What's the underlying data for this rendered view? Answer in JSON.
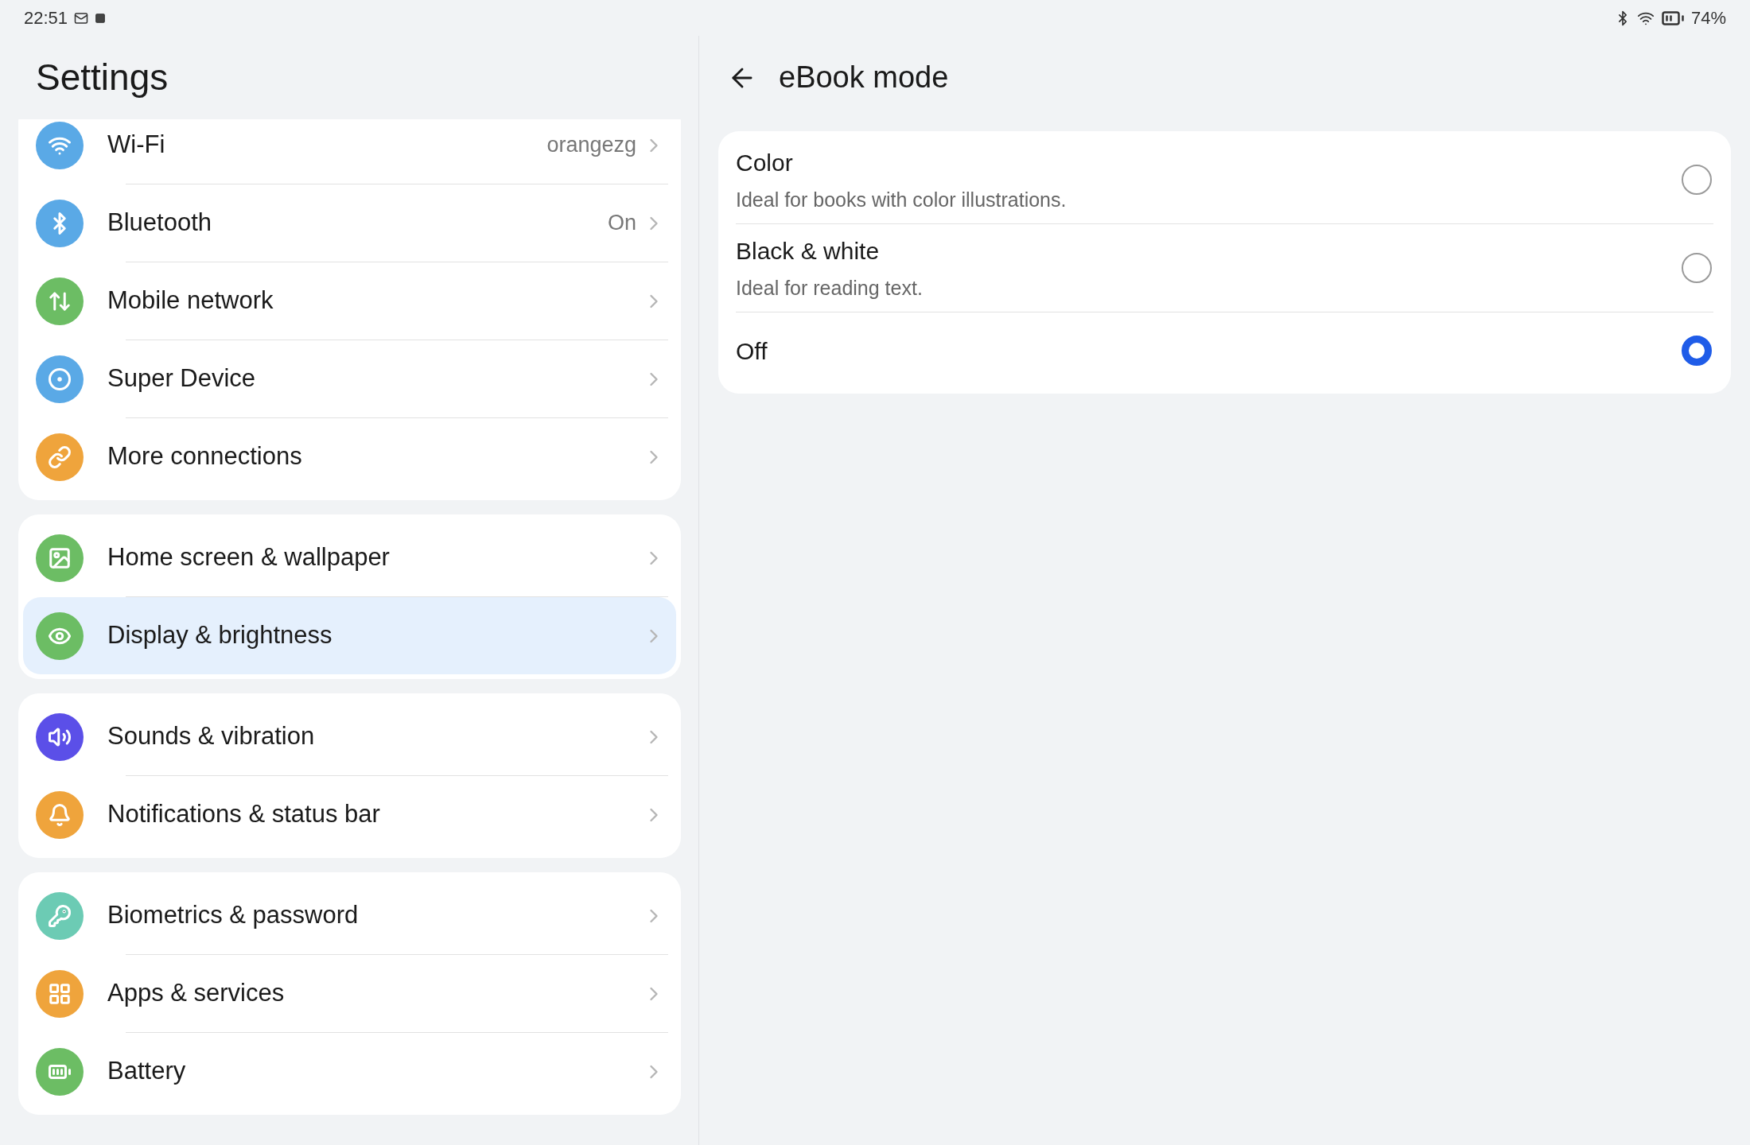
{
  "status_bar": {
    "time": "22:51",
    "battery": "74%"
  },
  "sidebar": {
    "title": "Settings",
    "groups": [
      {
        "items": [
          {
            "label": "Wi-Fi",
            "value": "orangezg",
            "selected": false,
            "color": "#5aa9e6"
          },
          {
            "label": "Bluetooth",
            "value": "On",
            "selected": false,
            "color": "#5aa9e6"
          },
          {
            "label": "Mobile network",
            "selected": false,
            "color": "#6cbd64"
          },
          {
            "label": "Super Device",
            "selected": false,
            "color": "#5aa9e6"
          },
          {
            "label": "More connections",
            "selected": false,
            "color": "#efa43c"
          }
        ]
      },
      {
        "items": [
          {
            "label": "Home screen & wallpaper",
            "selected": false,
            "color": "#6cbd64"
          },
          {
            "label": "Display & brightness",
            "selected": true,
            "color": "#6cbd64"
          }
        ]
      },
      {
        "items": [
          {
            "label": "Sounds & vibration",
            "selected": false,
            "color": "#5b4fe8"
          },
          {
            "label": "Notifications & status bar",
            "selected": false,
            "color": "#efa43c"
          }
        ]
      },
      {
        "items": [
          {
            "label": "Biometrics & password",
            "selected": false,
            "color": "#6ccbb4"
          },
          {
            "label": "Apps & services",
            "selected": false,
            "color": "#efa43c"
          },
          {
            "label": "Battery",
            "selected": false,
            "color": "#6cbd64"
          }
        ]
      }
    ]
  },
  "detail": {
    "title": "eBook mode",
    "options": [
      {
        "label": "Color",
        "description": "Ideal for books with color illustrations.",
        "selected": false
      },
      {
        "label": "Black & white",
        "description": "Ideal for reading text.",
        "selected": false
      },
      {
        "label": "Off",
        "selected": true
      }
    ]
  }
}
